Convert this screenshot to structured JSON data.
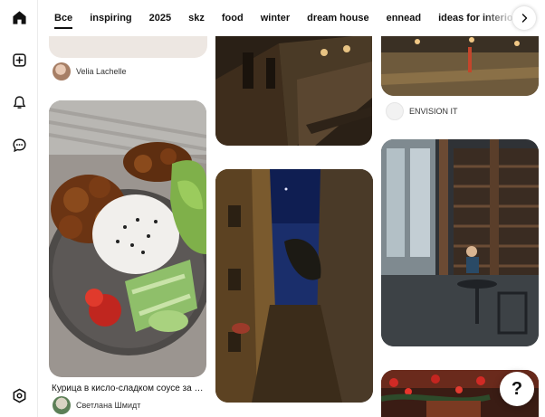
{
  "nav": {
    "icons": [
      "home-icon",
      "create-icon",
      "notifications-icon",
      "messages-icon",
      "settings-icon"
    ]
  },
  "tabs": [
    {
      "label": "Все",
      "active": true
    },
    {
      "label": "inspiring"
    },
    {
      "label": "2025"
    },
    {
      "label": "skz"
    },
    {
      "label": "food"
    },
    {
      "label": "winter"
    },
    {
      "label": "dream house"
    },
    {
      "label": "ennead"
    },
    {
      "label": "ideas for interior"
    }
  ],
  "pins": {
    "velia": {
      "author": "Velia Lachelle"
    },
    "bowl": {
      "title": "Курица в кисло-сладком соусе за 20…",
      "author": "Светлана Шмидт"
    },
    "envision": {
      "author": "ENVISION IT"
    }
  },
  "help_label": "?"
}
